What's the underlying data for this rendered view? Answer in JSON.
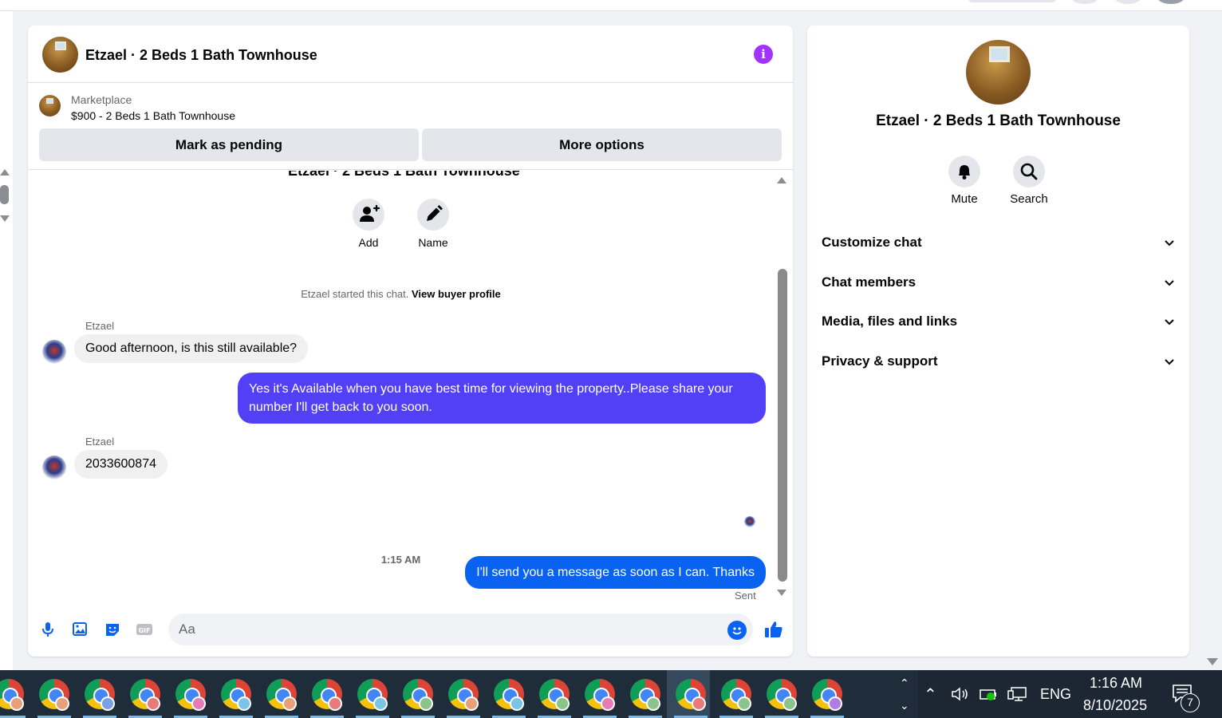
{
  "chat": {
    "header_title": "Etzael · 2 Beds 1 Bath Townhouse",
    "listing_label": "Marketplace",
    "listing_price": "$900 - 2 Beds 1 Bath Townhouse",
    "mark_pending_label": "Mark as pending",
    "more_options_label": "More options",
    "group_title": "Etzael · 2 Beds 1 Bath Townhouse",
    "actions": [
      {
        "label": "Add",
        "icon": "add-person-icon"
      },
      {
        "label": "Name",
        "icon": "pencil-icon"
      }
    ],
    "system_message": "Etzael started this chat.",
    "system_link": "View buyer profile",
    "messages": [
      {
        "sender": "Etzael",
        "direction": "in",
        "text": "Good afternoon, is this still available?"
      },
      {
        "sender": "me",
        "direction": "out",
        "text": "Yes it's Available when you have best time for viewing the property..Please share your number I'll get back to you soon."
      },
      {
        "sender": "Etzael",
        "direction": "in",
        "text": "2033600874"
      },
      {
        "sender": "me",
        "direction": "out",
        "text": "I'll send you a message as soon as I can. Thanks"
      }
    ],
    "timestamp": "1:15 AM",
    "sent_status": "Sent",
    "composer_placeholder": "Aa",
    "composer_icons": [
      "microphone-icon",
      "image-icon",
      "sticker-icon",
      "gif-icon",
      "emoji-icon",
      "thumbs-up-icon"
    ],
    "gif_label": "GIF"
  },
  "side": {
    "title": "Etzael · 2 Beds 1 Bath Townhouse",
    "buttons": [
      {
        "label": "Mute",
        "icon": "bell-icon"
      },
      {
        "label": "Search",
        "icon": "search-icon"
      }
    ],
    "sections": [
      "Customize chat",
      "Chat members",
      "Media, files and links",
      "Privacy & support"
    ]
  },
  "taskbar": {
    "language": "ENG",
    "time": "1:16 AM",
    "date": "8/10/2025",
    "notification_count": "7"
  },
  "colors": {
    "accent_purple": "#5140f5",
    "accent_blue": "#0a62f0",
    "info_purple": "#a033ff"
  }
}
